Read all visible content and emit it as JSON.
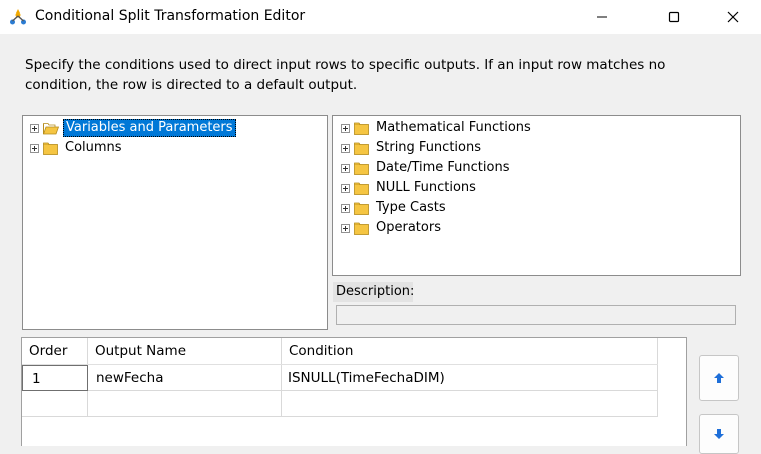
{
  "window": {
    "title": "Conditional Split Transformation Editor"
  },
  "instructions": "Specify the conditions used to direct input rows to specific outputs. If an input row matches no condition, the row is directed to a default output.",
  "left_tree": {
    "items": [
      {
        "label": "Variables and Parameters",
        "selected": true
      },
      {
        "label": "Columns",
        "selected": false
      }
    ]
  },
  "right_tree": {
    "items": [
      {
        "label": "Mathematical Functions"
      },
      {
        "label": "String Functions"
      },
      {
        "label": "Date/Time Functions"
      },
      {
        "label": "NULL Functions"
      },
      {
        "label": "Type Casts"
      },
      {
        "label": "Operators"
      }
    ]
  },
  "description": {
    "label": "Description:",
    "value": ""
  },
  "grid": {
    "columns": [
      "Order",
      "Output Name",
      "Condition"
    ],
    "rows": [
      {
        "order": "1",
        "output_name": "newFecha",
        "condition": "ISNULL(TimeFechaDIM)"
      },
      {
        "order": "",
        "output_name": "",
        "condition": ""
      }
    ]
  },
  "icons": {
    "app": "ssis-transform-icon",
    "move_up": "arrow-up-icon",
    "move_down": "arrow-down-icon"
  },
  "colors": {
    "selection": "#0078d7",
    "folder": "#f5c542",
    "arrow": "#1e6fd9"
  }
}
